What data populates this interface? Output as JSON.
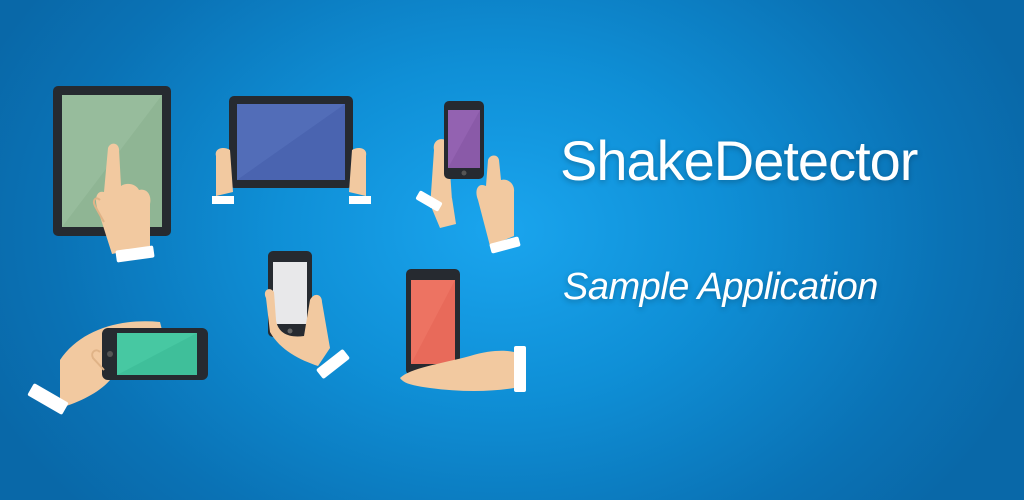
{
  "banner": {
    "title": "ShakeDetector",
    "subtitle": "Sample Application"
  },
  "colors": {
    "background": "#0f8fd6",
    "tablet_screen_green": "#8fb594",
    "tablet_screen_blue": "#4a64b0",
    "phone_screen_purple": "#8a5aa8",
    "phone_screen_white": "#e8e8ea",
    "phone_screen_red": "#e86a5a",
    "phone_screen_teal": "#3fbf9a",
    "skin": "#f2c9a0",
    "device_body": "#262a30"
  },
  "illustrations": [
    "tablet-touch-illustration",
    "tablet-landscape-illustration",
    "phone-tap-illustration",
    "phone-landscape-illustration",
    "phone-hold-illustration",
    "phone-palm-illustration"
  ]
}
